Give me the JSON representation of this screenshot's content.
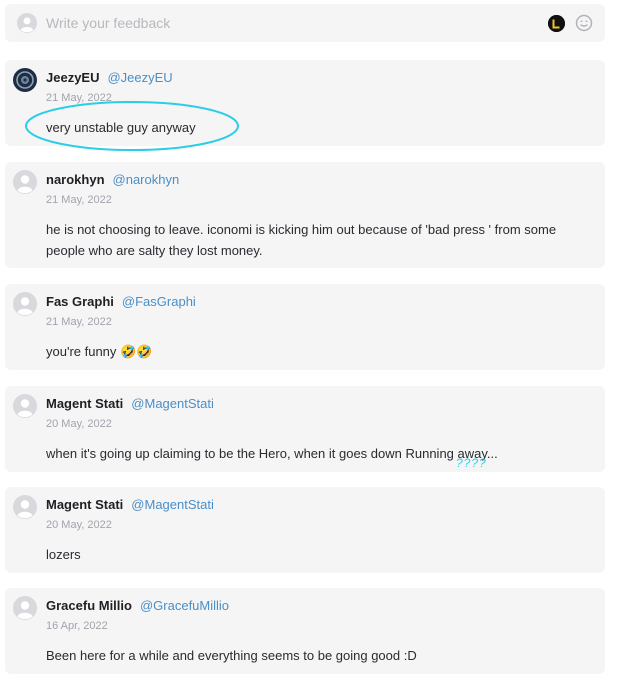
{
  "feedback": {
    "placeholder": "Write your feedback"
  },
  "comments": [
    {
      "name": "JeezyEU",
      "handle": "@JeezyEU",
      "date": "21 May, 2022",
      "text": "very unstable guy anyway"
    },
    {
      "name": "narokhyn",
      "handle": "@narokhyn",
      "date": "21 May, 2022",
      "text": "he is not choosing to leave. iconomi is kicking him out because of 'bad press ' from some people who are salty they lost money."
    },
    {
      "name": "Fas Graphi",
      "handle": "@FasGraphi",
      "date": "21 May, 2022",
      "text": "you're funny 🤣🤣"
    },
    {
      "name": "Magent Stati",
      "handle": "@MagentStati",
      "date": "20 May, 2022",
      "text": "when it's going up claiming to be the Hero, when it goes down Running away..."
    },
    {
      "name": "Magent Stati",
      "handle": "@MagentStati",
      "date": "20 May, 2022",
      "text": "lozers"
    },
    {
      "name": "Gracefu Millio",
      "handle": "@GracefuMillio",
      "date": "16 Apr, 2022",
      "text": "Been here for a while and everything seems to be going good :D"
    }
  ],
  "annotations": {
    "marks": "????"
  },
  "colors": {
    "card_bg": "#f5f5f6",
    "handle": "#4a8fc7",
    "annotation": "#2ccde6"
  }
}
